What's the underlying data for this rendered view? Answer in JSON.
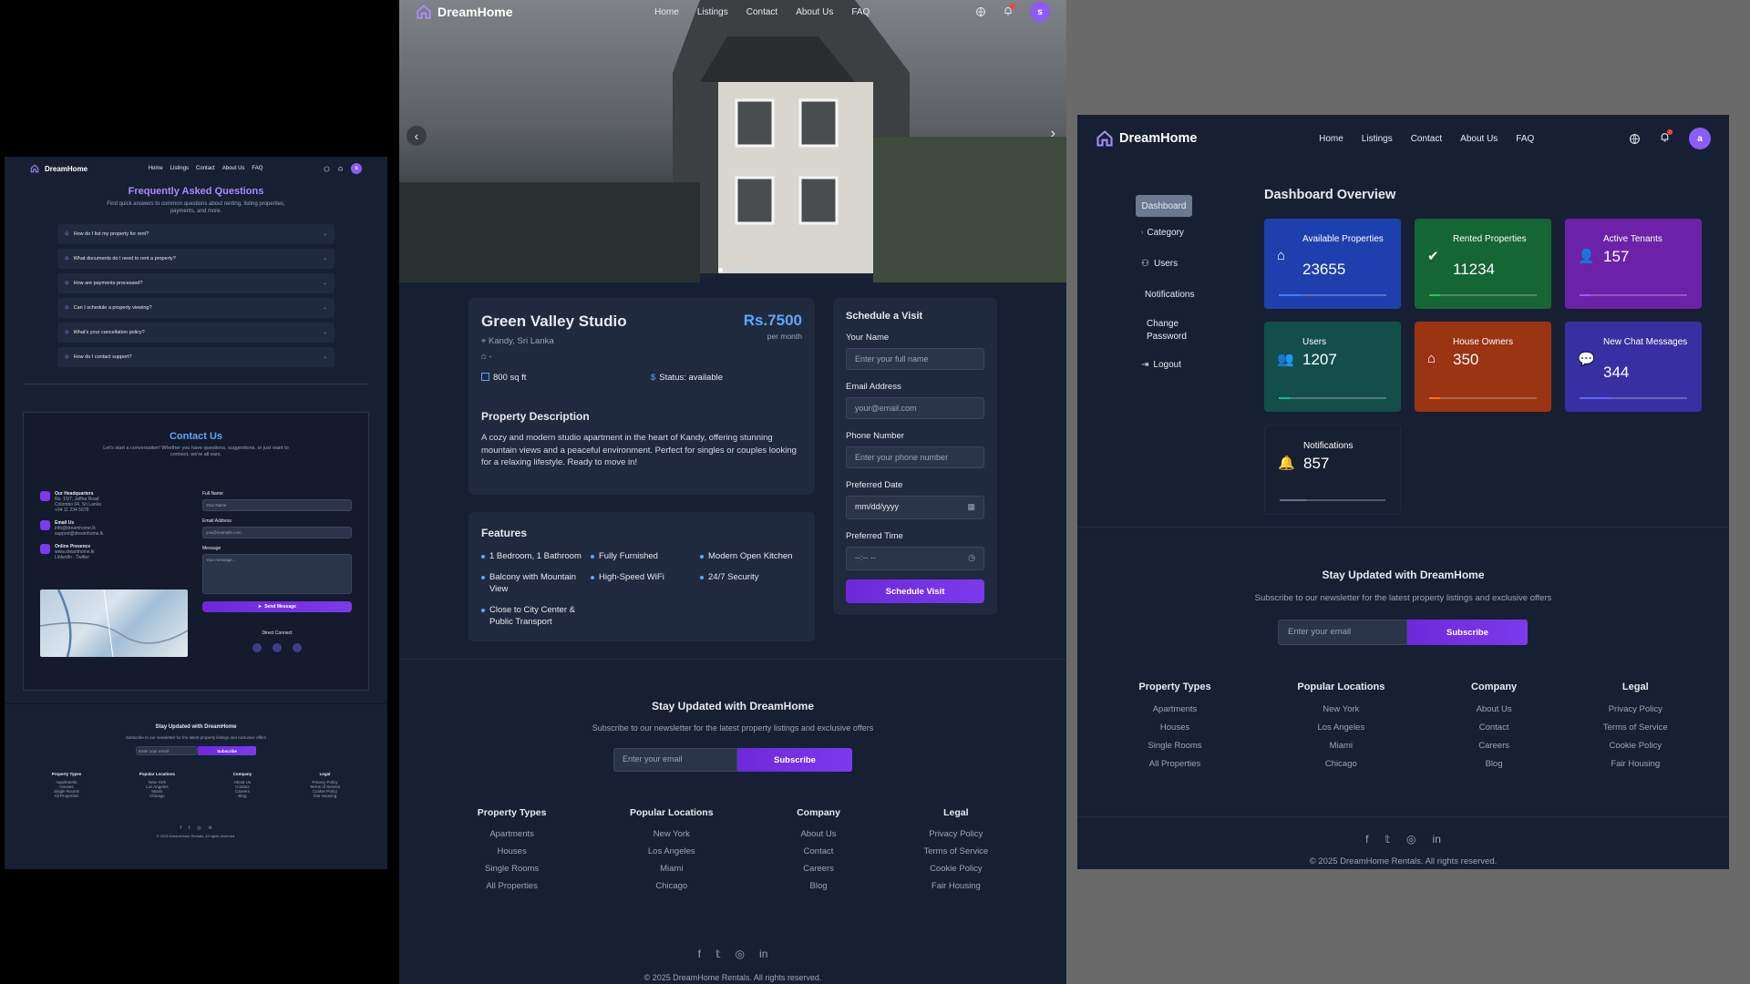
{
  "brand": "DreamHome",
  "nav": [
    "Home",
    "Listings",
    "Contact",
    "About Us",
    "FAQ"
  ],
  "faq": {
    "title": "Frequently Asked Questions",
    "subtitle": "Find quick answers to common questions about renting, listing properties, payments, and more.",
    "questions": [
      "How do I list my property for rent?",
      "What documents do I need to rent a property?",
      "How are payments processed?",
      "Can I schedule a property viewing?",
      "What's your cancellation policy?",
      "How do I contact support?"
    ],
    "avatar": "s",
    "contact": {
      "title": "Contact Us",
      "subtitle": "Let's start a conversation! Whether you have questions, suggestions, or just want to connect, we're all ears.",
      "items": [
        {
          "label": "Our Headquarters",
          "lines": [
            "No. 15/7, Jaffna Road",
            "Colombo 04, Sri Lanka",
            "+94 11 234 5678"
          ]
        },
        {
          "label": "Email Us",
          "lines": [
            "info@dreamhome.lk",
            "support@dreamhome.lk"
          ]
        },
        {
          "label": "Online Presence",
          "lines": [
            "www.dreamhome.lk",
            "LinkedIn · Twitter"
          ]
        }
      ],
      "full_name_label": "Full Name",
      "full_name_ph": "Your Name",
      "email_label": "Email Address",
      "email_ph": "you@example.com",
      "message_label": "Message",
      "message_ph": "Your message...",
      "send": "Send Message",
      "direct": "Direct Connect"
    }
  },
  "listing": {
    "avatar": "s",
    "title": "Green Valley Studio",
    "location": "Kandy, Sri Lanka",
    "type_line": "-",
    "price": "Rs.7500",
    "per": "per month",
    "size": "800 sq ft",
    "status": "Status: available",
    "desc_title": "Property Description",
    "desc": "A cozy and modern studio apartment in the heart of Kandy, offering stunning mountain views and a peaceful environment. Perfect for singles or couples looking for a relaxing lifestyle. Ready to move in!",
    "features_title": "Features",
    "features": [
      "1 Bedroom, 1 Bathroom",
      "Fully Furnished",
      "Modern Open Kitchen",
      "Balcony with Mountain View",
      "High-Speed WiFi",
      "24/7 Security",
      "Close to City Center & Public Transport"
    ],
    "schedule": {
      "title": "Schedule a Visit",
      "name_label": "Your Name",
      "name_ph": "Enter your full name",
      "email_label": "Email Address",
      "email_ph": "your@email.com",
      "phone_label": "Phone Number",
      "phone_ph": "Enter your phone number",
      "date_label": "Preferred Date",
      "date_ph": "mm/dd/yyyy",
      "time_label": "Preferred Time",
      "time_ph": "--:-- --",
      "button": "Schedule Visit"
    }
  },
  "dashboard": {
    "avatar": "a",
    "sidebar": [
      "Dashboard",
      "Category",
      "Users",
      "Notifications",
      "Change Password",
      "Logout"
    ],
    "title": "Dashboard Overview",
    "stats": [
      {
        "label": "Available Properties",
        "value": "23655",
        "color": "#1e40af",
        "bar": "#3b82f6",
        "fill": 0.2,
        "icon": "house-icon"
      },
      {
        "label": "Rented Properties",
        "value": "11234",
        "color": "#166534",
        "bar": "#22c55e",
        "fill": 0.1,
        "icon": "check-circle-icon"
      },
      {
        "label": "Active Tenants",
        "value": "157",
        "color": "#6b21a8",
        "bar": "#a855f7",
        "fill": 0.1,
        "icon": "user-icon"
      },
      {
        "label": "Users",
        "value": "1207",
        "color": "#134e4a",
        "bar": "#14b8a6",
        "fill": 0.1,
        "icon": "users-icon"
      },
      {
        "label": "House Owners",
        "value": "350",
        "color": "#9a3412",
        "bar": "#f97316",
        "fill": 0.1,
        "icon": "house-icon"
      },
      {
        "label": "New Chat Messages",
        "value": "344",
        "color": "#3730a3",
        "bar": "#6366f1",
        "fill": 0.3,
        "icon": "chat-icon"
      },
      {
        "label": "Notifications",
        "value": "857",
        "color": "#172033",
        "bar": "#64748b",
        "fill": 0.25,
        "icon": "bell-icon"
      }
    ]
  },
  "newsletter": {
    "title": "Stay Updated with DreamHome",
    "subtitle": "Subscribe to our newsletter for the latest property listings and exclusive offers",
    "placeholder": "Enter your email",
    "button": "Subscribe"
  },
  "footer": {
    "columns": [
      {
        "title": "Property Types",
        "items": [
          "Apartments",
          "Houses",
          "Single Rooms",
          "All Properties"
        ]
      },
      {
        "title": "Popular Locations",
        "items": [
          "New York",
          "Los Angeles",
          "Miami",
          "Chicago"
        ]
      },
      {
        "title": "Company",
        "items": [
          "About Us",
          "Contact",
          "Careers",
          "Blog"
        ]
      },
      {
        "title": "Legal",
        "items": [
          "Privacy Policy",
          "Terms of Service",
          "Cookie Policy",
          "Fair Housing"
        ]
      }
    ],
    "copyright": "© 2025 DreamHome Rentals. All rights reserved."
  }
}
